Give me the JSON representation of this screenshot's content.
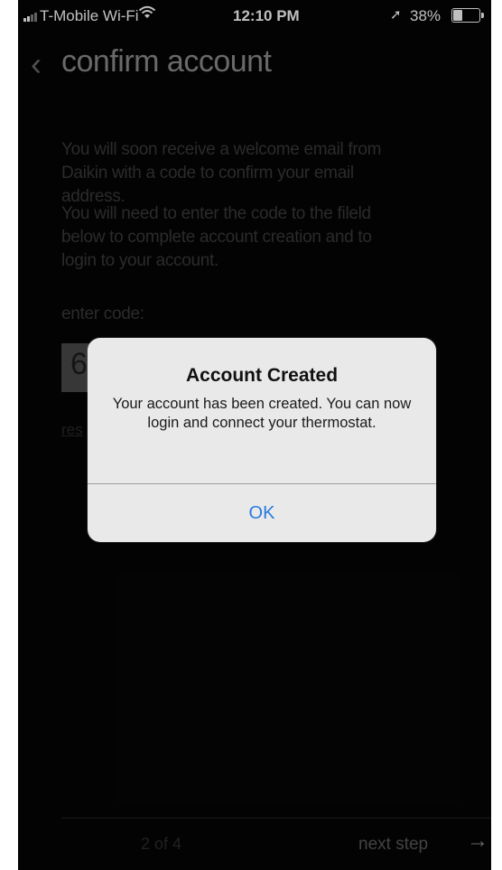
{
  "status_bar": {
    "carrier": "T-Mobile Wi-Fi",
    "wifi_icon": "wifi-icon",
    "time": "12:10 PM",
    "location_icon": "location-arrow-icon",
    "battery_percent": "38%",
    "battery_level": 0.38
  },
  "nav": {
    "back_icon": "chevron-left-icon",
    "title": "confirm account"
  },
  "body": {
    "paragraph1": "You will soon receive a welcome email from Daikin with a code to confirm your email address.",
    "paragraph2": "You will need to enter the code to the fileld below to complete account creation and to login to your account.",
    "code_label": "enter code:",
    "code_value": "6",
    "resend_link": "res"
  },
  "footer": {
    "step_indicator": "2 of 4",
    "next_label": "next step",
    "next_icon": "arrow-right-icon"
  },
  "alert": {
    "title": "Account Created",
    "message": "Your account has been created.  You can now login and connect your thermostat.",
    "ok_label": "OK",
    "accent_color": "#2a7be0"
  }
}
